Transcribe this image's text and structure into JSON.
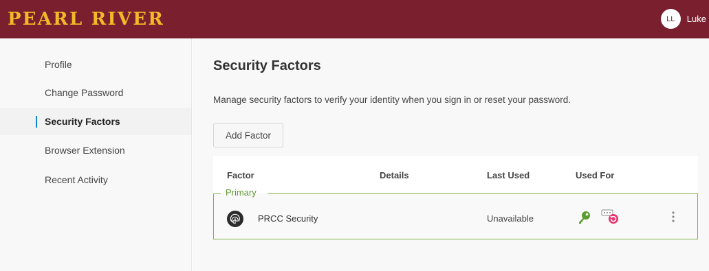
{
  "header": {
    "logo": "PEARL RIVER",
    "user_initials": "LL",
    "user_name": "Luke"
  },
  "sidebar": {
    "items": [
      {
        "label": "Profile",
        "active": false
      },
      {
        "label": "Change Password",
        "active": false
      },
      {
        "label": "Security Factors",
        "active": true
      },
      {
        "label": "Browser Extension",
        "active": false
      },
      {
        "label": "Recent Activity",
        "active": false
      }
    ]
  },
  "main": {
    "title": "Security Factors",
    "description": "Manage security factors to verify your identity when you sign in or reset your password.",
    "add_button_label": "Add Factor",
    "table": {
      "columns": [
        "Factor",
        "Details",
        "Last Used",
        "Used For"
      ],
      "group_label": "Primary",
      "rows": [
        {
          "factor": "PRCC Security",
          "details": "",
          "last_used": "Unavailable",
          "used_for_icons": [
            "key-icon",
            "password-reset-icon"
          ]
        }
      ]
    }
  },
  "colors": {
    "brand_maroon": "#7a1f2e",
    "brand_gold": "#f2b928",
    "accent_blue": "#0d8bc9",
    "group_green": "#7cb342",
    "key_green": "#5a9e2f",
    "reset_pink": "#e8336d"
  }
}
